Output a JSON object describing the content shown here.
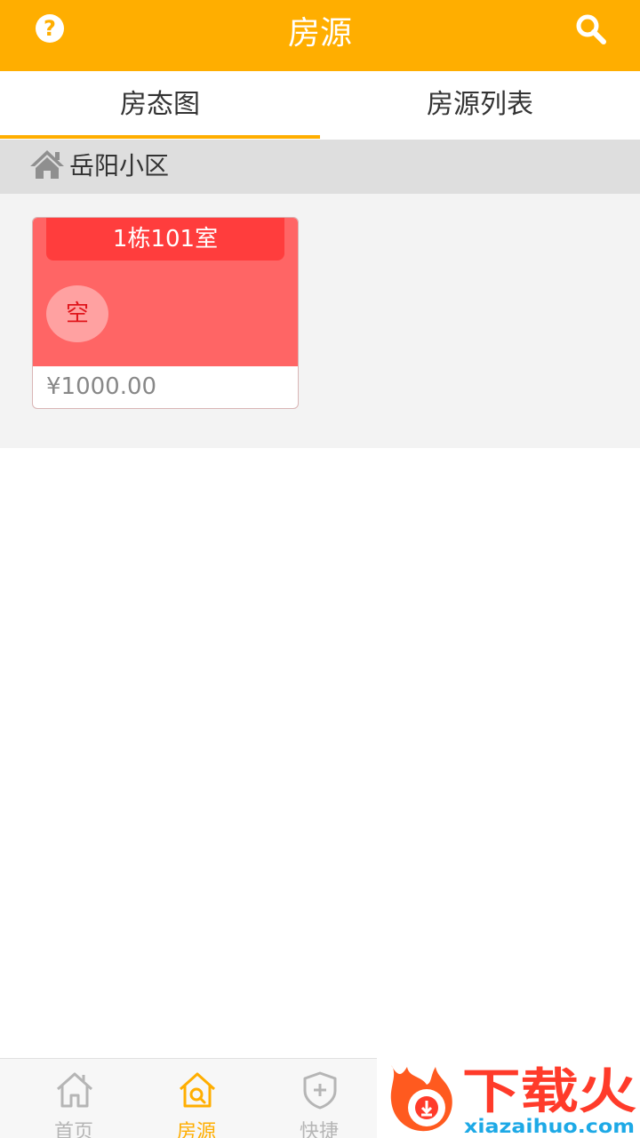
{
  "header": {
    "title": "房源",
    "help_icon": "help-circle-icon",
    "search_icon": "search-icon",
    "help_glyph": "?"
  },
  "tabs": [
    {
      "label": "房态图",
      "active": true
    },
    {
      "label": "房源列表",
      "active": false
    }
  ],
  "community": {
    "icon": "home-icon",
    "name": "岳阳小区"
  },
  "rooms": [
    {
      "label": "1栋101室",
      "status": "空",
      "price": "¥1000.00",
      "color": "#ff6565"
    }
  ],
  "bottom_nav": [
    {
      "label": "首页",
      "icon": "home-outline-icon",
      "active": false
    },
    {
      "label": "房源",
      "icon": "house-search-icon",
      "active": true
    },
    {
      "label": "快捷",
      "icon": "shield-plus-icon",
      "active": false
    }
  ],
  "watermark": {
    "text": "下载火",
    "url_text": "xiazaihuo.com"
  },
  "colors": {
    "accent": "#ffae00",
    "room_card": "#ff6565",
    "room_label": "#ff3d3d"
  }
}
